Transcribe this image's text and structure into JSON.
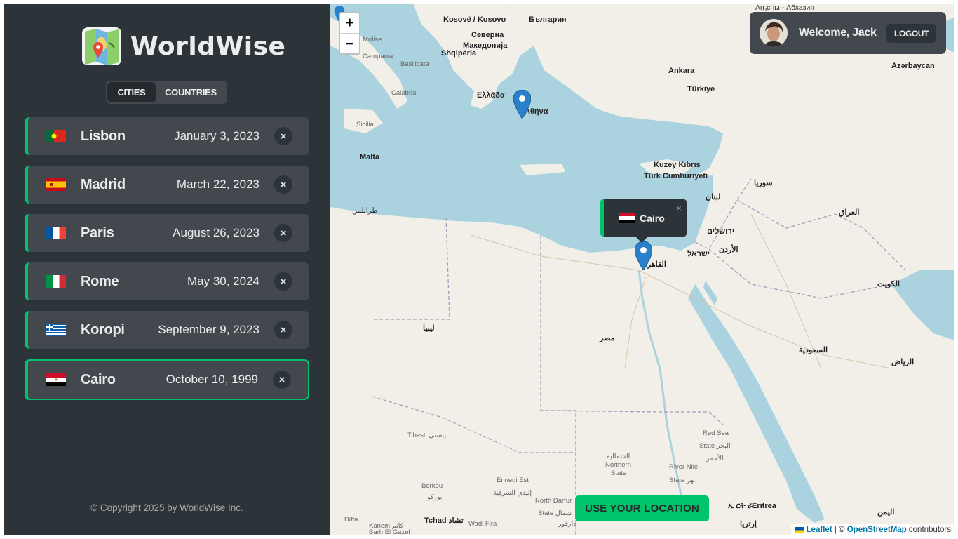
{
  "app": {
    "name": "WorldWise"
  },
  "tabs": [
    {
      "label": "CITIES",
      "active": true
    },
    {
      "label": "COUNTRIES",
      "active": false
    }
  ],
  "cities": [
    {
      "name": "Lisbon",
      "date": "January 3, 2023",
      "flag": "portugal",
      "selected": false
    },
    {
      "name": "Madrid",
      "date": "March 22, 2023",
      "flag": "spain",
      "selected": false
    },
    {
      "name": "Paris",
      "date": "August 26, 2023",
      "flag": "france",
      "selected": false
    },
    {
      "name": "Rome",
      "date": "May 30, 2024",
      "flag": "italy",
      "selected": false
    },
    {
      "name": "Koropi",
      "date": "September 9, 2023",
      "flag": "greece",
      "selected": false
    },
    {
      "name": "Cairo",
      "date": "October 10, 1999",
      "flag": "egypt",
      "selected": true
    }
  ],
  "delete_symbol": "×",
  "footer": {
    "copyright": "© Copyright 2025 by WorldWise Inc."
  },
  "user": {
    "welcome": "Welcome, Jack",
    "logout_label": "LOGOUT"
  },
  "map": {
    "zoom_in": "+",
    "zoom_out": "−",
    "popup": {
      "city": "Cairo",
      "close": "×"
    },
    "geolocation_button": "USE YOUR LOCATION",
    "attribution": {
      "leaflet": "Leaflet",
      "separator": " | © ",
      "osm": "OpenStreetMap",
      "suffix": " contributors"
    },
    "labels": {
      "abkhazia": "Аҧсны - Абхазия",
      "kosovo": "Kosovë / Kosovo",
      "bulgaria": "България",
      "north_macedonia_1": "Северна",
      "north_macedonia_2": "Македонија",
      "albania": "Shqipëria",
      "molise": "Molise",
      "campania": "Campania",
      "basilicata": "Basilicata",
      "calabria": "Calabria",
      "sicilia": "Sicilia",
      "malta": "Malta",
      "greece": "Ελλάδα",
      "athens": "Αθήνα",
      "ankara": "Ankara",
      "turkey": "Türkiye",
      "azerbaijan": "Azərbaycan",
      "cyprus_1": "Kuzey Kıbrıs",
      "cyprus_2": "Türk Cumhuriyeti",
      "syria": "سوريا",
      "lebanon": "لبنان",
      "iraq": "العراق",
      "jerusalem": "ירושלים",
      "israel": "ישראל",
      "jordan": "الأردن",
      "kuwait": "الكويت",
      "tripoli": "طرابلس",
      "cairo": "القاهرة",
      "libya": "ليبيا",
      "egypt": "مصر",
      "saudi": "السعودية",
      "riyadh": "الرياض",
      "red_sea_1": "Red Sea",
      "red_sea_2": "State البحر",
      "red_sea_3": "الأحمر",
      "northern_state_1": "الشمالية",
      "northern_state_2": "Northern",
      "northern_state_3": "State",
      "river_nile_1": "River Nile",
      "river_nile_2": "State نهر",
      "tibesti": "Tibesti تيبستي",
      "borkou_1": "Borkou",
      "borkou_2": "بوركو",
      "ennedi_1": "Ennedi Est",
      "ennedi_2": "إنيدي الشرقية",
      "north_darfur_1": "North Darfur",
      "north_darfur_2": "State شمال",
      "north_darfur_3": "دارفور",
      "chad": "Tchad تشاد",
      "diffa": "Diffa",
      "kanem": "Kanem كانم",
      "bahr": "Barh El Gazel",
      "wadi_fira": "Wadi Fira",
      "eritrea_1": "ኤ ርት ራ",
      "eritrea_2": "Eritrea",
      "eritrea_3": "إرتريا",
      "yemen": "اليمن"
    }
  },
  "colors": {
    "accent": "#00c46a",
    "dark": "#242a2e",
    "sidebar": "#2d3439",
    "card": "#42484d",
    "text": "#ececec",
    "sea": "#aad3df"
  }
}
